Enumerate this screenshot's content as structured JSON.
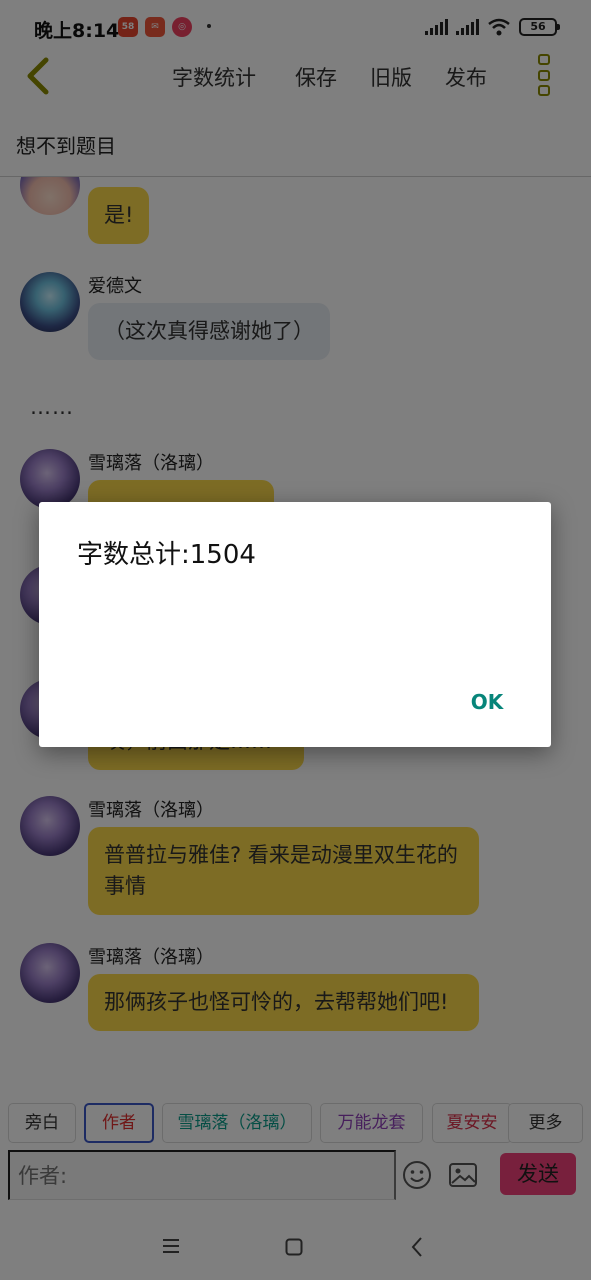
{
  "status_bar": {
    "time": "晚上8:14",
    "app_badges": [
      "58"
    ],
    "battery": "56"
  },
  "toolbar": {
    "word_count": "字数统计",
    "save": "保存",
    "old_version": "旧版",
    "publish": "发布"
  },
  "subtitle": "想不到题目",
  "messages": [
    {
      "avatar": "character-avatar",
      "text": "是!"
    },
    {
      "name": "爱德文",
      "avatar": "character-avatar",
      "text": "（这次真得感谢她了）"
    },
    {
      "narration": "……"
    },
    {
      "name": "雪璃落（洛璃）",
      "avatar": "character-avatar",
      "text": ""
    },
    {
      "avatar": "character-avatar",
      "text": ""
    },
    {
      "avatar": "character-avatar",
      "text": "唉，前面那是……"
    },
    {
      "name": "雪璃落（洛璃）",
      "avatar": "character-avatar",
      "text": "普普拉与雅佳? 看来是动漫里双生花的事情"
    },
    {
      "name": "雪璃落（洛璃）",
      "avatar": "character-avatar",
      "text": "那俩孩子也怪可怜的，去帮帮她们吧!"
    }
  ],
  "roles": [
    {
      "label": "旁白",
      "color": "#333333"
    },
    {
      "label": "作者",
      "color": "#e03030"
    },
    {
      "label": "雪璃落（洛璃）",
      "color": "#0a9c8a"
    },
    {
      "label": "万能龙套",
      "color": "#8e3fb8"
    },
    {
      "label": "夏安安",
      "color": "#d8304a"
    },
    {
      "label": "更多",
      "color": "#333333"
    }
  ],
  "input": {
    "placeholder": "作者:",
    "send": "发送"
  },
  "dialog": {
    "message": "字数总计:1504",
    "ok": "OK"
  },
  "colors": {
    "bubble_yellow": "#fbd94a",
    "bubble_grey": "#e6ecf2",
    "send_button": "#f0407a",
    "dialog_ok": "#07857a",
    "active_role_border": "#3a56c7"
  }
}
